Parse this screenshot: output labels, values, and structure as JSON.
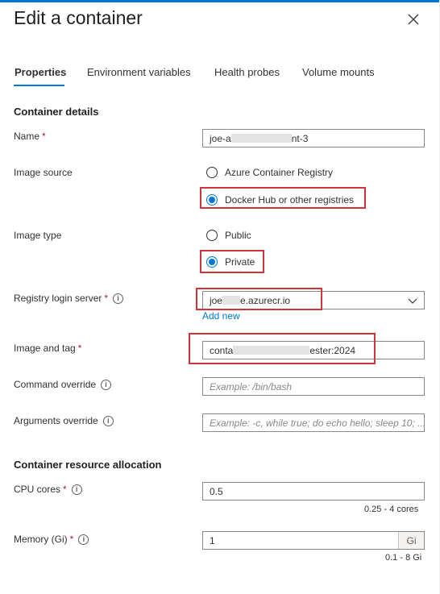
{
  "panel": {
    "title": "Edit a container"
  },
  "tabs": [
    {
      "label": "Properties",
      "active": true
    },
    {
      "label": "Environment variables",
      "active": false
    },
    {
      "label": "Health probes",
      "active": false
    },
    {
      "label": "Volume mounts",
      "active": false
    }
  ],
  "container_details": {
    "heading": "Container details",
    "name": {
      "label": "Name",
      "required": "*",
      "value_start": "joe-a",
      "value_end": "nt-3"
    },
    "image_source": {
      "label": "Image source",
      "options": [
        "Azure Container Registry",
        "Docker Hub or other registries"
      ],
      "selected": "Docker Hub or other registries"
    },
    "image_type": {
      "label": "Image type",
      "options": [
        "Public",
        "Private"
      ],
      "selected": "Private"
    },
    "registry_login_server": {
      "label": "Registry login server",
      "required": "*",
      "value_start": "joe",
      "value_end": "e.azurecr.io",
      "add_new": "Add new"
    },
    "image_and_tag": {
      "label": "Image and tag",
      "required": "*",
      "value_start": "conta",
      "value_end": "ester:2024"
    },
    "command_override": {
      "label": "Command override",
      "placeholder": "Example: /bin/bash"
    },
    "arguments_override": {
      "label": "Arguments override",
      "placeholder": "Example: -c, while true; do echo hello; sleep 10; ..."
    }
  },
  "resource_allocation": {
    "heading": "Container resource allocation",
    "cpu_cores": {
      "label": "CPU cores",
      "required": "*",
      "value": "0.5",
      "hint": "0.25 - 4 cores"
    },
    "memory": {
      "label": "Memory (Gi)",
      "required": "*",
      "value": "1",
      "unit": "Gi",
      "hint": "0.1 - 8 Gi"
    }
  },
  "icons": {
    "info": "i",
    "close": "close-icon",
    "chevron": "chevron-down-icon"
  },
  "colors": {
    "accent": "#0078d4",
    "highlight_box": "#d13438",
    "required": "#a4262c"
  }
}
